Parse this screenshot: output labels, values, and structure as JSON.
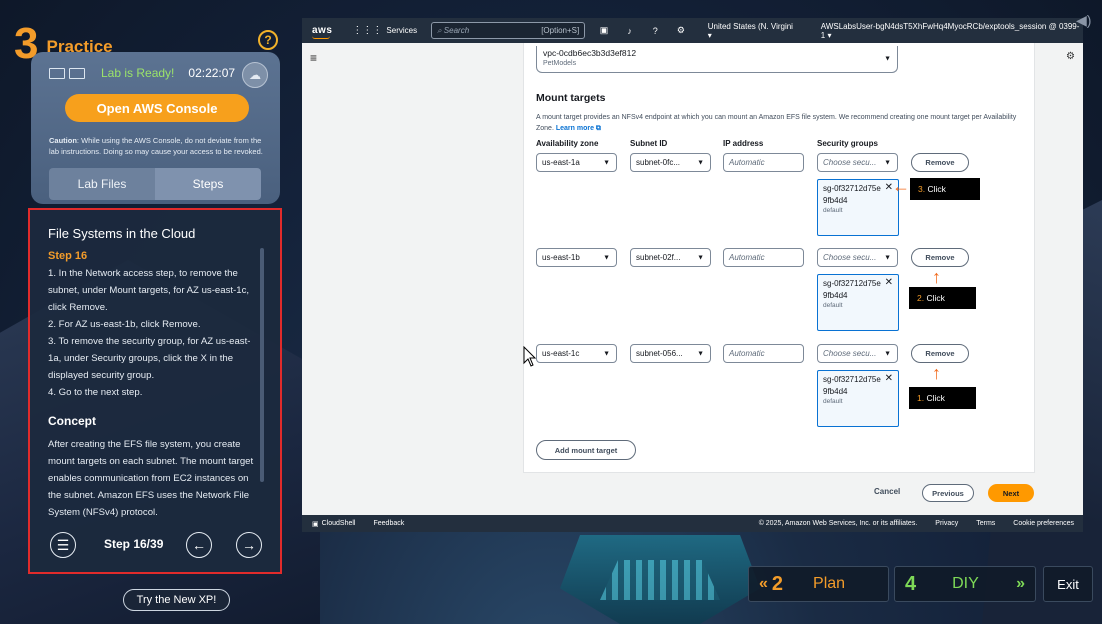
{
  "practice": {
    "number": "3",
    "label": "Practice",
    "help": "?"
  },
  "lab": {
    "status": "Lab is Ready!",
    "timer": "02:22:07",
    "open_console": "Open AWS Console",
    "caution_label": "Caution",
    "caution_text": ": While using the AWS Console, do not deviate from the lab instructions. Doing so may cause your access to be revoked.",
    "tabs": [
      {
        "label": "Lab Files"
      },
      {
        "label": "Steps"
      }
    ]
  },
  "steps": {
    "title": "File Systems in the Cloud",
    "step_label": "Step 16",
    "instructions": [
      "1. In the Network access step, to remove the subnet, under Mount targets, for AZ us-east-1c, click Remove.",
      "2. For AZ us-east-1b, click Remove.",
      "3. To remove the security group, for AZ us-east-1a, under Security groups, click the X in the displayed security group.",
      "4. Go to the next step."
    ],
    "concept_title": "Concept",
    "concept_text": "After creating the EFS file system, you create mount targets on each subnet. The mount target enables communication from EC2 instances on the subnet. Amazon EFS uses the Network File System (NFSv4) protocol.",
    "counter": "Step 16/39"
  },
  "try_new": "Try the New XP!",
  "aws": {
    "logo": "aws",
    "services": "Services",
    "search_placeholder": "Search",
    "search_shortcut": "[Option+S]",
    "region": "United States (N. Virgini",
    "account": "AWSLabsUser-bgN4dsT5XhFwHq4MyocRCb/exptools_session @ 0399-1",
    "vpc_value": "vpc-0cdb6ec3b3d3ef812",
    "vpc_name": "PetModels",
    "mount_targets_heading": "Mount targets",
    "mount_targets_desc": "A mount target provides an NFSv4 endpoint at which you can mount an Amazon EFS file system. We recommend creating one mount target per Availability Zone.",
    "learn_more": "Learn more",
    "columns": {
      "az": "Availability zone",
      "subnet": "Subnet ID",
      "ip": "IP address",
      "sg": "Security groups"
    },
    "rows": [
      {
        "az": "us-east-1a",
        "subnet": "subnet-0fc...",
        "ip_placeholder": "Automatic",
        "sg_placeholder": "Choose secu...",
        "remove": "Remove",
        "token": "sg-0f32712d75e9fb4d4",
        "token_sub": "default"
      },
      {
        "az": "us-east-1b",
        "subnet": "subnet-02f...",
        "ip_placeholder": "Automatic",
        "sg_placeholder": "Choose secu...",
        "remove": "Remove",
        "token": "sg-0f32712d75e9fb4d4",
        "token_sub": "default"
      },
      {
        "az": "us-east-1c",
        "subnet": "subnet-056...",
        "ip_placeholder": "Automatic",
        "sg_placeholder": "Choose secu...",
        "remove": "Remove",
        "token": "sg-0f32712d75e9fb4d4",
        "token_sub": "default"
      }
    ],
    "callouts": [
      {
        "num": "3.",
        "text": "Click"
      },
      {
        "num": "2.",
        "text": "Click"
      },
      {
        "num": "1.",
        "text": "Click"
      }
    ],
    "add_mount_target": "Add mount target",
    "cancel": "Cancel",
    "previous": "Previous",
    "next": "Next",
    "footer": {
      "cloudshell": "CloudShell",
      "feedback": "Feedback",
      "copyright": "© 2025, Amazon Web Services, Inc. or its affiliates.",
      "privacy": "Privacy",
      "terms": "Terms",
      "cookies": "Cookie preferences"
    }
  },
  "nav": {
    "plan_num": "2",
    "plan_label": "Plan",
    "diy_num": "4",
    "diy_label": "DIY",
    "exit": "Exit"
  },
  "colors": {
    "accent_orange": "#f39c2a",
    "aws_orange": "#ff9900",
    "diy_green": "#7ed957",
    "highlight_red": "#e12b2b"
  }
}
